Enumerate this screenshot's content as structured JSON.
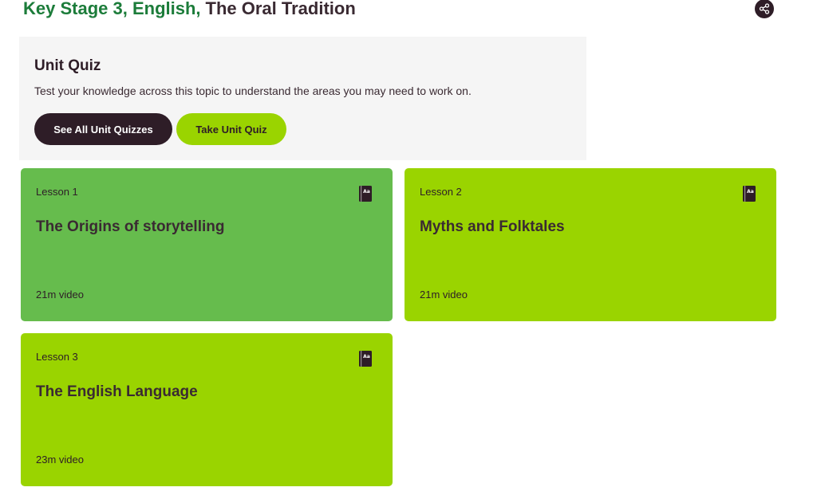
{
  "header": {
    "crumb_prefix": "Key Stage 3, English,",
    "unit_title": "The Oral Tradition",
    "share_icon": "share-icon"
  },
  "quiz": {
    "title": "Unit Quiz",
    "description": "Test your knowledge across this topic to understand the areas you may need to work on.",
    "see_all_label": "See All Unit Quizzes",
    "take_quiz_label": "Take Unit Quiz"
  },
  "lessons": [
    {
      "number": "Lesson 1",
      "title": "The Origins of storytelling",
      "meta": "21m video",
      "icon": "book-icon",
      "color": "#66bc4d"
    },
    {
      "number": "Lesson 2",
      "title": "Myths and Folktales",
      "meta": "21m video",
      "icon": "book-icon",
      "color": "#9ad400"
    },
    {
      "number": "Lesson 3",
      "title": "The English Language",
      "meta": "23m video",
      "icon": "book-icon",
      "color": "#9ad400"
    }
  ],
  "colors": {
    "brand_green": "#1c7c3a",
    "dark": "#2e1d27",
    "lime": "#9ad400",
    "panel_bg": "#f5f5f5"
  }
}
